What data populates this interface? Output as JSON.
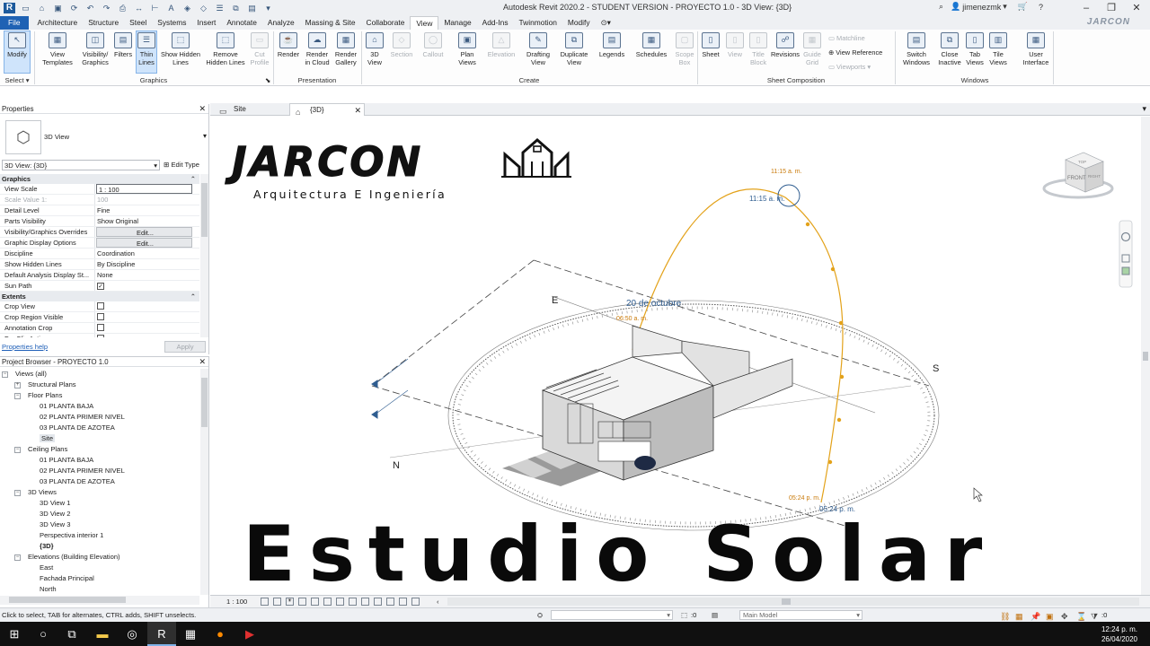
{
  "window": {
    "title": "Autodesk Revit 2020.2 - STUDENT VERSION - PROYECTO 1.0 - 3D View: {3D}",
    "username": "jimenezmk",
    "brand": "JARCON"
  },
  "tabs": [
    "File",
    "Architecture",
    "Structure",
    "Steel",
    "Systems",
    "Insert",
    "Annotate",
    "Analyze",
    "Massing & Site",
    "Collaborate",
    "View",
    "Manage",
    "Add-Ins",
    "Twinmotion",
    "Modify"
  ],
  "active_tab": "View",
  "ribbon": {
    "select": {
      "modify": "Modify",
      "select_label": "Select"
    },
    "graphics": {
      "label": "Graphics",
      "view_templates": "View Templates",
      "visibility_graphics": "Visibility/ Graphics",
      "filters": "Filters",
      "thin_lines": "Thin Lines",
      "show_hidden_lines": "Show Hidden Lines",
      "remove_hidden_lines": "Remove Hidden Lines",
      "cut_profile": "Cut Profile"
    },
    "presentation": {
      "label": "Presentation",
      "render": "Render",
      "render_cloud": "Render in Cloud",
      "render_gallery": "Render Gallery"
    },
    "create": {
      "label": "Create",
      "view_3d": "3D View",
      "section": "Section",
      "callout": "Callout",
      "plan_views": "Plan Views",
      "elevation": "Elevation",
      "drafting_view": "Drafting View",
      "duplicate_view": "Duplicate View",
      "legends": "Legends",
      "schedules": "Schedules",
      "scope_box": "Scope Box"
    },
    "sheet": {
      "label": "Sheet Composition",
      "sheet": "Sheet",
      "view": "View",
      "title_block": "Title Block",
      "revisions": "Revisions",
      "guide_grid": "Guide Grid",
      "matchline": "Matchline",
      "view_reference": "View Reference",
      "viewports": "Viewports"
    },
    "windows": {
      "label": "Windows",
      "switch_windows": "Switch Windows",
      "close_inactive": "Close Inactive",
      "tab_views": "Tab Views",
      "tile_views": "Tile Views"
    },
    "ui": {
      "user_interface": "User Interface"
    }
  },
  "properties": {
    "title": "Properties",
    "type_name": "3D View",
    "instance": "3D View: {3D}",
    "edit_type": "Edit Type",
    "categories": {
      "graphics": "Graphics",
      "extents": "Extents"
    },
    "rows": [
      {
        "k": "View Scale",
        "v": "1 : 100"
      },
      {
        "k": "Scale Value    1:",
        "v": "100"
      },
      {
        "k": "Detail Level",
        "v": "Fine"
      },
      {
        "k": "Parts Visibility",
        "v": "Show Original"
      },
      {
        "k": "Visibility/Graphics Overrides",
        "v": "Edit..."
      },
      {
        "k": "Graphic Display Options",
        "v": "Edit..."
      },
      {
        "k": "Discipline",
        "v": "Coordination"
      },
      {
        "k": "Show Hidden Lines",
        "v": "By Discipline"
      },
      {
        "k": "Default Analysis Display St...",
        "v": "None"
      },
      {
        "k": "Sun Path",
        "v": ""
      }
    ],
    "extents_rows": [
      {
        "k": "Crop View"
      },
      {
        "k": "Crop Region Visible"
      },
      {
        "k": "Annotation Crop"
      },
      {
        "k": "Far Clip Active"
      }
    ],
    "help": "Properties help",
    "apply": "Apply"
  },
  "browser": {
    "title": "Project Browser - PROYECTO 1.0",
    "nodes": [
      {
        "t": "Views (all)",
        "d": 0,
        "exp": "-"
      },
      {
        "t": "Structural Plans",
        "d": 1,
        "exp": "+"
      },
      {
        "t": "Floor Plans",
        "d": 1,
        "exp": "-"
      },
      {
        "t": "01 PLANTA BAJA",
        "d": 2
      },
      {
        "t": "02 PLANTA PRIMER NIVEL",
        "d": 2
      },
      {
        "t": "03 PLANTA DE AZOTEA",
        "d": 2
      },
      {
        "t": "Site",
        "d": 2,
        "sel": true
      },
      {
        "t": "Ceiling Plans",
        "d": 1,
        "exp": "-"
      },
      {
        "t": "01 PLANTA BAJA",
        "d": 2
      },
      {
        "t": "02 PLANTA PRIMER NIVEL",
        "d": 2
      },
      {
        "t": "03 PLANTA DE AZOTEA",
        "d": 2
      },
      {
        "t": "3D Views",
        "d": 1,
        "exp": "-"
      },
      {
        "t": "3D View 1",
        "d": 2
      },
      {
        "t": "3D View 2",
        "d": 2
      },
      {
        "t": "3D View 3",
        "d": 2
      },
      {
        "t": "Perspectiva interior 1",
        "d": 2
      },
      {
        "t": "{3D}",
        "d": 2,
        "bold": true
      },
      {
        "t": "Elevations (Building Elevation)",
        "d": 1,
        "exp": "-"
      },
      {
        "t": "East",
        "d": 2
      },
      {
        "t": "Fachada Principal",
        "d": 2
      },
      {
        "t": "North",
        "d": 2
      }
    ]
  },
  "doc_tabs": [
    {
      "label": "Site",
      "active": false
    },
    {
      "label": "{3D}",
      "active": true
    }
  ],
  "scene": {
    "compass": {
      "E": "E",
      "S": "S",
      "N": "N"
    },
    "date_label": "20 de octubre",
    "sun_times": [
      "11:15 a. m.",
      "11:15 a. m.",
      "06:50 a. m.",
      "05:24 p. m.",
      "05:24 p. m."
    ],
    "viewcube": {
      "top": "TOP",
      "front": "FRONT",
      "right": "RIGHT"
    }
  },
  "overlay": {
    "logo_word": "JARCON",
    "tagline": "Arquitectura E Ingeniería",
    "title": "Estudio Solar"
  },
  "viewbar": {
    "scale": "1 : 100"
  },
  "status": {
    "hint": "Click to select, TAB for alternates, CTRL adds, SHIFT unselects.",
    "zero": ":0",
    "model": "Main Model"
  },
  "clock": {
    "time": "12:24 p. m.",
    "date": "26/04/2020"
  },
  "colors": {
    "accent": "#1f62b4",
    "sun_path": "#e3a21a",
    "ribbon_highlight": "#cfe4fb"
  }
}
